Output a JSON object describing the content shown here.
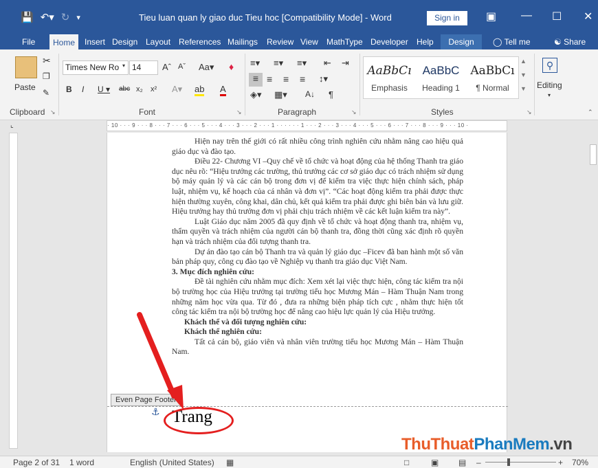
{
  "titlebar": {
    "title": "Tieu luan quan ly giao duc Tieu hoc [Compatibility Mode] - Word",
    "signin": "Sign in"
  },
  "tabs": [
    "File",
    "Home",
    "Insert",
    "Design",
    "Layout",
    "References",
    "Mailings",
    "Review",
    "View",
    "MathType",
    "Developer",
    "Help",
    "Design"
  ],
  "tellme": "Tell me",
  "share": "Share",
  "ribbon": {
    "clipboard": {
      "label": "Clipboard",
      "paste": "Paste"
    },
    "font": {
      "label": "Font",
      "family": "Times New Ro",
      "size": "14"
    },
    "paragraph": {
      "label": "Paragraph"
    },
    "styles": {
      "label": "Styles",
      "items": [
        {
          "preview": "AaBbCı",
          "name": "Emphasis"
        },
        {
          "preview": "AaBbC",
          "name": "Heading 1"
        },
        {
          "preview": "AaBbCı",
          "name": "¶ Normal"
        }
      ]
    },
    "editing": {
      "label": "Editing"
    }
  },
  "ruler": "· 10 · · · 9 · · · 8 · · · 7 · · · 6 · · · 5 · · · 4 · · · 3 · · · 2 · · · 1 · · · · · · 1 · · · 2 · · · 3 · · · 4 · · · 5 · · · 6 · · · 7 · · · 8 · · · 9 · · · 10 ·",
  "document": {
    "paragraphs": [
      "Hiện nay trên thế giới có rất nhiều công trình nghiên cứu nhằm nâng cao hiệu quả giáo dục và đào tạo.",
      "Điều 22- Chương VI –Quy chế về tổ chức và hoạt động của hệ thống Thanh tra giáo dục nêu rõ: “Hiệu trưởng các trường, thủ trưởng các cơ sở giáo dục có trách nhiệm sử dụng bộ máy quản lý và các cán bộ trong đơn vị để kiểm tra việc thực hiện chính sách, pháp luật, nhiệm vụ, kế hoạch của cá nhân và đơn vị”. “Các hoạt động kiểm tra phải được thực hiện thường xuyên, công khai, dân chủ, kết quả kiểm tra phải được ghi biên bản và lưu giữ. Hiệu trưởng hay thủ trưởng đơn vị phải chịu trách nhiệm về các kết luận kiểm tra này”.",
      "Luật Giáo dục năm 2005 đã quy định về tổ chức và hoạt động thanh tra, nhiệm vụ, thẩm quyền và trách nhiệm của người cán bộ thanh tra, đồng thời cũng xác định rõ quyền hạn và trách nhiệm của đối tượng thanh tra.",
      "Dự án đào tạo cán bộ Thanh tra và quản lý giáo dục –Ficev đã ban hành một số văn bản pháp quy, công cụ đào tạo về Nghiệp vụ thanh tra giáo dục Việt Nam."
    ],
    "heading3": "3. Mục đích nghiên cứu:",
    "para5": "Đề tài nghiên cứu nhằm mục đích: Xem xét lại việc thực hiện, công tác kiểm tra nội bộ trường học của Hiệu trưởng tại trường tiểu học Mương Mán – Hàm Thuận Nam trong những năm học vừa qua. Từ đó , đưa ra những biện pháp tích cực , nhằm thực hiện tốt công tác kiểm tra nội bộ trường học để nâng cao hiệu lực quản lý của Hiệu trưởng.",
    "heading4": "Khách thể và đối tượng nghiên cứu:",
    "heading41": "Khách thể nghiên cứu:",
    "para6": "Tất cả cán bộ, giáo viên và nhân viên trường tiểu học Mương Mán – Hàm Thuận Nam."
  },
  "footer": {
    "tag": "Even Page Footer",
    "text": "Trang"
  },
  "status": {
    "page": "Page 2 of 31",
    "words": "1 word",
    "language": "English (United States)",
    "zoom": "70%"
  },
  "watermark": {
    "part1": "ThuThuat",
    "part2": "PhanMem",
    "part3": ".vn"
  },
  "colors": {
    "accent": "#2b579a",
    "annotation": "#e41f1f"
  }
}
